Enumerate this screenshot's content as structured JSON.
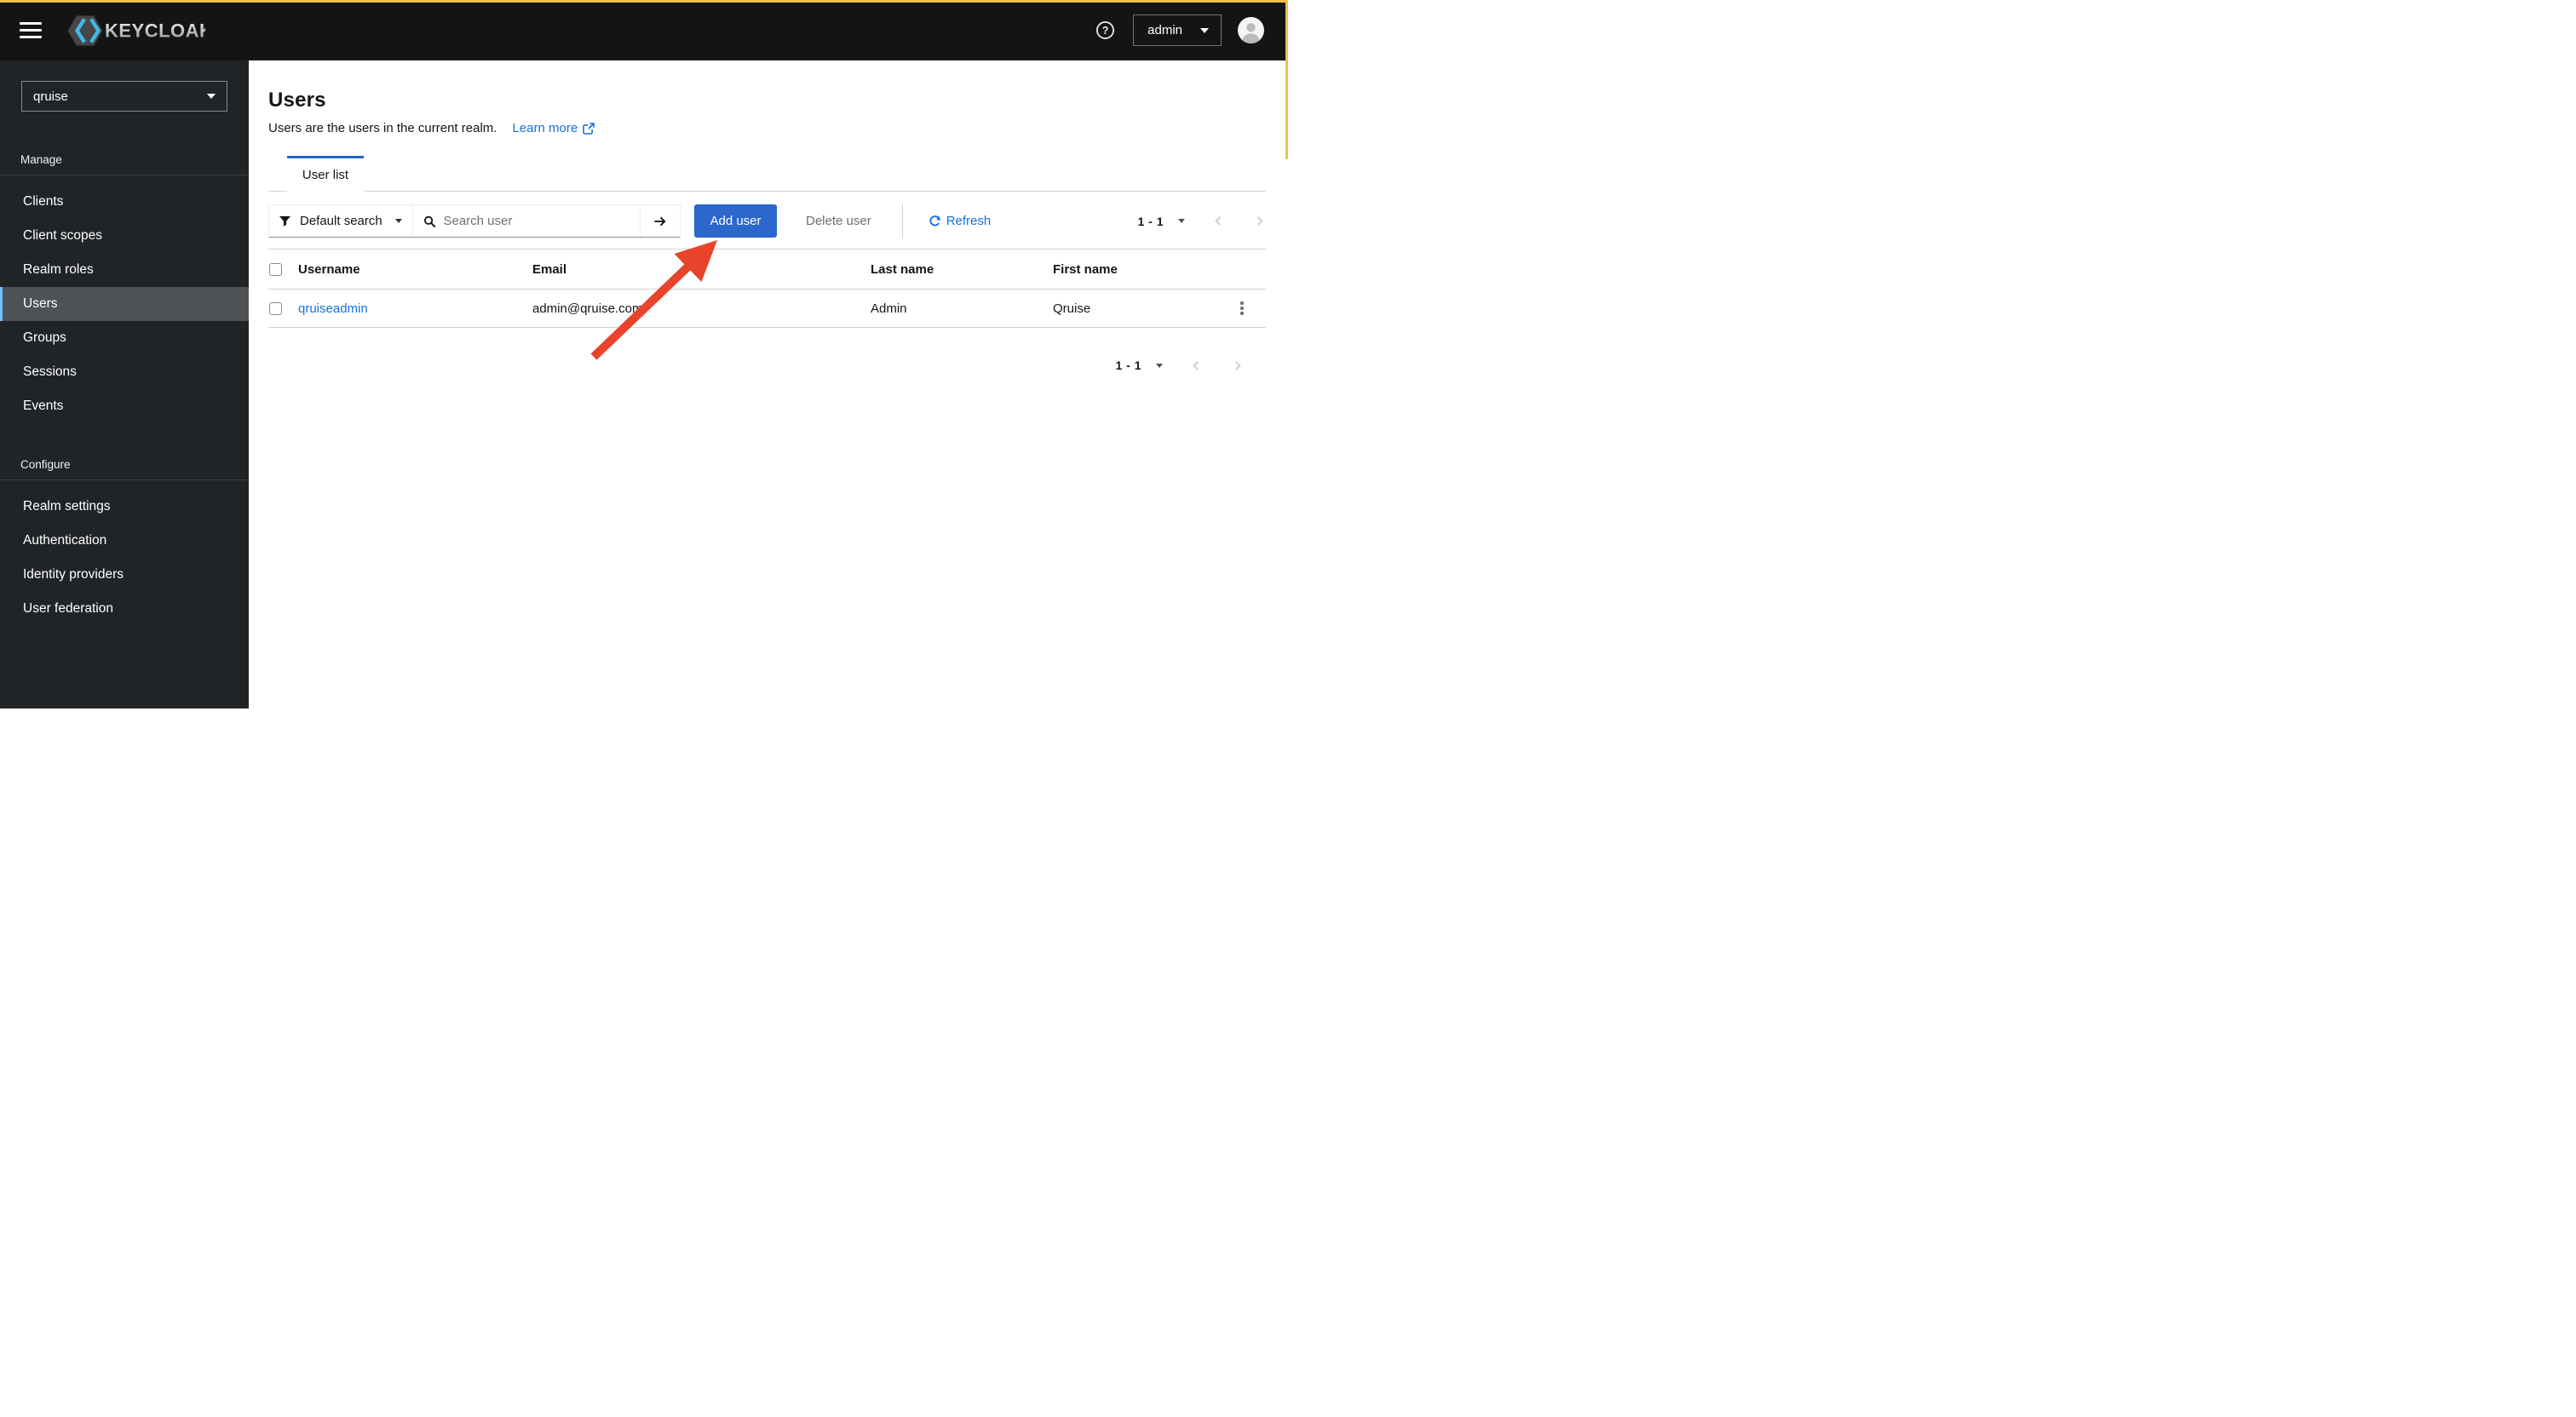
{
  "window": {
    "highlight_border_color": "#eec24a"
  },
  "header": {
    "product_name": "KEYCLOAK",
    "menu_icon": "hamburger-icon",
    "help_icon": "question-circle-icon",
    "user_menu": {
      "label": "admin"
    },
    "avatar_icon": "user-avatar-icon"
  },
  "sidebar": {
    "realm_selector": {
      "value": "qruise"
    },
    "sections": [
      {
        "label": "Manage",
        "items": [
          {
            "label": "Clients",
            "active": false
          },
          {
            "label": "Client scopes",
            "active": false
          },
          {
            "label": "Realm roles",
            "active": false
          },
          {
            "label": "Users",
            "active": true
          },
          {
            "label": "Groups",
            "active": false
          },
          {
            "label": "Sessions",
            "active": false
          },
          {
            "label": "Events",
            "active": false
          }
        ]
      },
      {
        "label": "Configure",
        "items": [
          {
            "label": "Realm settings",
            "active": false
          },
          {
            "label": "Authentication",
            "active": false
          },
          {
            "label": "Identity providers",
            "active": false
          },
          {
            "label": "User federation",
            "active": false
          }
        ]
      }
    ]
  },
  "main": {
    "title": "Users",
    "subtitle": "Users are the users in the current realm.",
    "learn_more": "Learn more",
    "tabs": [
      {
        "label": "User list",
        "active": true
      }
    ],
    "toolbar": {
      "filter_label": "Default search",
      "search_placeholder": "Search user",
      "add_user_label": "Add user",
      "delete_user_label": "Delete user",
      "refresh_label": "Refresh",
      "pagination": {
        "range": "1 - 1"
      }
    },
    "table": {
      "headers": [
        "Username",
        "Email",
        "Last name",
        "First name"
      ],
      "rows": [
        {
          "username": "qruiseadmin",
          "email": "admin@qruise.com",
          "last_name": "Admin",
          "first_name": "Qruise"
        }
      ]
    },
    "footer_pagination": {
      "range": "1 - 1"
    }
  },
  "annotation": {
    "type": "arrow",
    "color": "#e8432b",
    "points_to": "add-user-button"
  },
  "colors": {
    "accent_button": "#2b67cd",
    "tab_active_bar": "#2166cf",
    "link": "#1570dc",
    "sidebar_bg": "#212427",
    "sidebar_active_bg": "#4f5255",
    "sidebar_active_bar": "#73bcf7",
    "masthead_bg": "#141414",
    "disabled_text": "#6a6e73",
    "border": "#d2d2d2"
  }
}
